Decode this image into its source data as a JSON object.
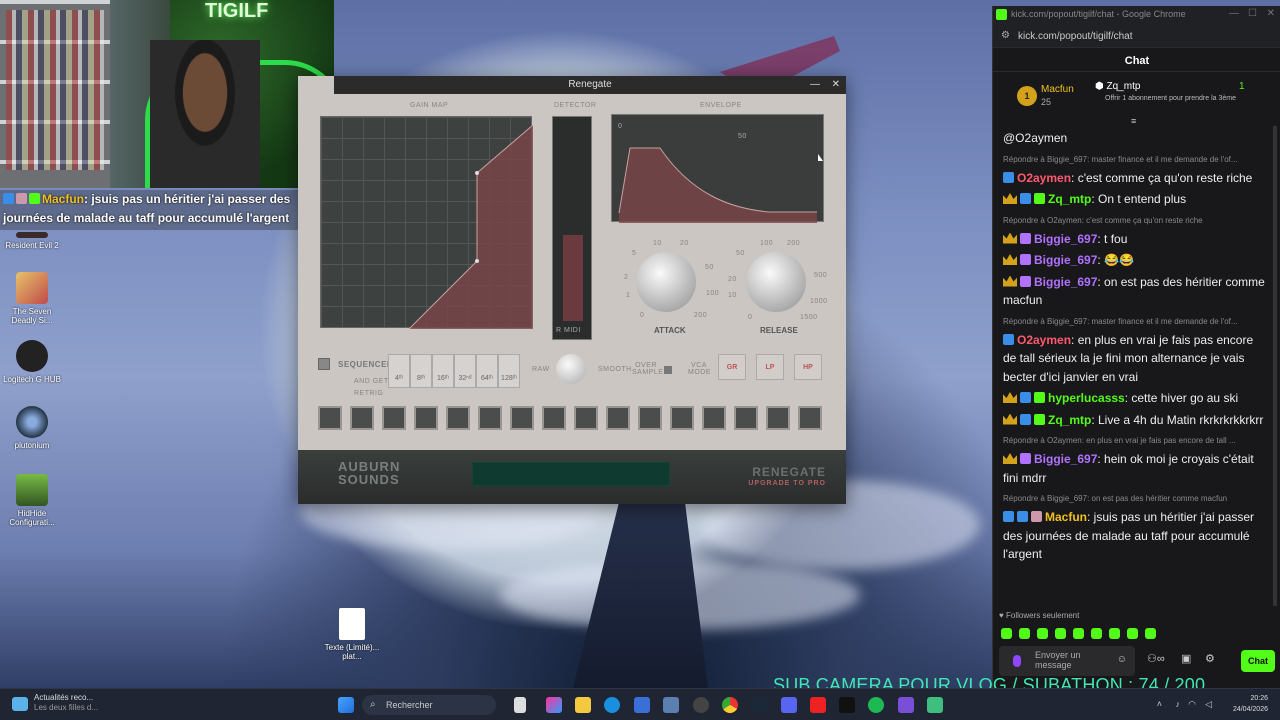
{
  "webcam": {
    "neon_sign": "TIGILF"
  },
  "overlay_chat": {
    "username": "Macfun",
    "text": ": jsuis pas un héritier j'ai passer des journées de malade au taff pour accumulé l'argent"
  },
  "desktop_icons": [
    {
      "label": "Resident Evil 2"
    },
    {
      "label": "The Seven Deadly Si..."
    },
    {
      "label": "Logitech G HUB"
    },
    {
      "label": "plutonium"
    },
    {
      "label": "HidHide Configurati..."
    },
    {
      "label": "Texte (Limité)... plat..."
    }
  ],
  "plugin": {
    "title": "Renegate",
    "sections": {
      "gain_map": "GAIN MAP",
      "detector": "DETECTOR",
      "envelope": "ENVELOPE",
      "midi": "R MIDI"
    },
    "attack": {
      "label": "ATTACK",
      "ticks": [
        "10",
        "20",
        "5",
        "50",
        "2",
        "100",
        "1",
        "200",
        "0"
      ]
    },
    "release": {
      "label": "RELEASE",
      "ticks": [
        "100",
        "200",
        "50",
        "500",
        "20",
        "1000",
        "10",
        "1500",
        "0"
      ]
    },
    "sequencer": {
      "label": "SEQUENCER",
      "and_get": "AND GET",
      "retrig": "RETRIG",
      "divisions": [
        "4ᵗʰ",
        "8ᵗʰ",
        "16ᵗʰ",
        "32ⁿᵈ",
        "64ᵗʰ",
        "128ᵗʰ"
      ]
    },
    "controls": {
      "raw": "RAW",
      "smooth": "SMOOTH",
      "oversample": "OVER SAMPLE",
      "vca_mode": "VCA MODE",
      "gr": "GR",
      "lp": "LP",
      "hp": "HP"
    },
    "env_ticks": [
      "0",
      "50"
    ],
    "brand": "AUBURN SOUNDS",
    "product": "RENEGATE",
    "upgrade": "UPGRADE TO PRO"
  },
  "browser": {
    "window_title": "kick.com/popout/tigilf/chat - Google Chrome",
    "url": "kick.com/popout/tigilf/chat",
    "header": "Chat"
  },
  "pinned": {
    "gifter": "Macfun",
    "gifter_count": "25",
    "rank": "1",
    "recipient": "Zq_mtp",
    "count": "1",
    "note": "Offrir 1 abonnement pour prendre la 3ème"
  },
  "messages": [
    {
      "type": "text",
      "text": "@O2aymen"
    },
    {
      "type": "reply",
      "text": "Répondre à Biggie_697: master finance et il me demande de l'of..."
    },
    {
      "type": "msg",
      "user": "O2aymen",
      "color": "#ff5a6e",
      "text": ": c'est comme ça qu'on reste riche"
    },
    {
      "type": "msg",
      "user": "Zq_mtp",
      "color": "#53fc18",
      "text": ": On t entend plus"
    },
    {
      "type": "reply",
      "text": "Répondre à O2aymen: c'est comme ça qu'on reste riche"
    },
    {
      "type": "msg",
      "user": "Biggie_697",
      "color": "#b072ff",
      "text": ": t fou"
    },
    {
      "type": "msg",
      "user": "Biggie_697",
      "color": "#b072ff",
      "text": ": 😂😂"
    },
    {
      "type": "msg",
      "user": "Biggie_697",
      "color": "#b072ff",
      "text": ": on est pas des héritier comme macfun"
    },
    {
      "type": "reply",
      "text": "Répondre à Biggie_697: master finance et il me demande de l'of..."
    },
    {
      "type": "msg",
      "user": "O2aymen",
      "color": "#ff5a6e",
      "text": ": en plus en vrai je fais pas encore de tall sérieux la je fini mon alternance je vais becter d'ici janvier en vrai"
    },
    {
      "type": "msg",
      "user": "hyperlucasss",
      "color": "#53fc18",
      "text": ": cette hiver go au ski"
    },
    {
      "type": "msg",
      "user": "Zq_mtp",
      "color": "#53fc18",
      "text": ": Live a 4h du Matin rkrkrkrkkrkrr"
    },
    {
      "type": "reply",
      "text": "Répondre à O2aymen: en plus en vrai je fais pas encore de tall ..."
    },
    {
      "type": "msg",
      "user": "Biggie_697",
      "color": "#b072ff",
      "text": ": hein ok moi je croyais c'était fini mdrr"
    },
    {
      "type": "reply",
      "text": "Répondre à Biggie_697: on est pas des héritier comme macfun"
    },
    {
      "type": "msg",
      "user": "Macfun",
      "color": "#f0c020",
      "text": ": jsuis pas un héritier j'ai passer des journées de malade au taff pour accumulé l'argent"
    }
  ],
  "chat_footer": {
    "followers": "Followers seulement",
    "placeholder": "Envoyer un message",
    "send": "Chat"
  },
  "subathon": "SUB CAMERA POUR VLOG / SUBATHON  :  74 / 200",
  "taskbar": {
    "news_title": "Actualités reco...",
    "news_sub": "Les deux filles d...",
    "search": "Rechercher",
    "time": "20:26",
    "date": "24/04/2026"
  }
}
